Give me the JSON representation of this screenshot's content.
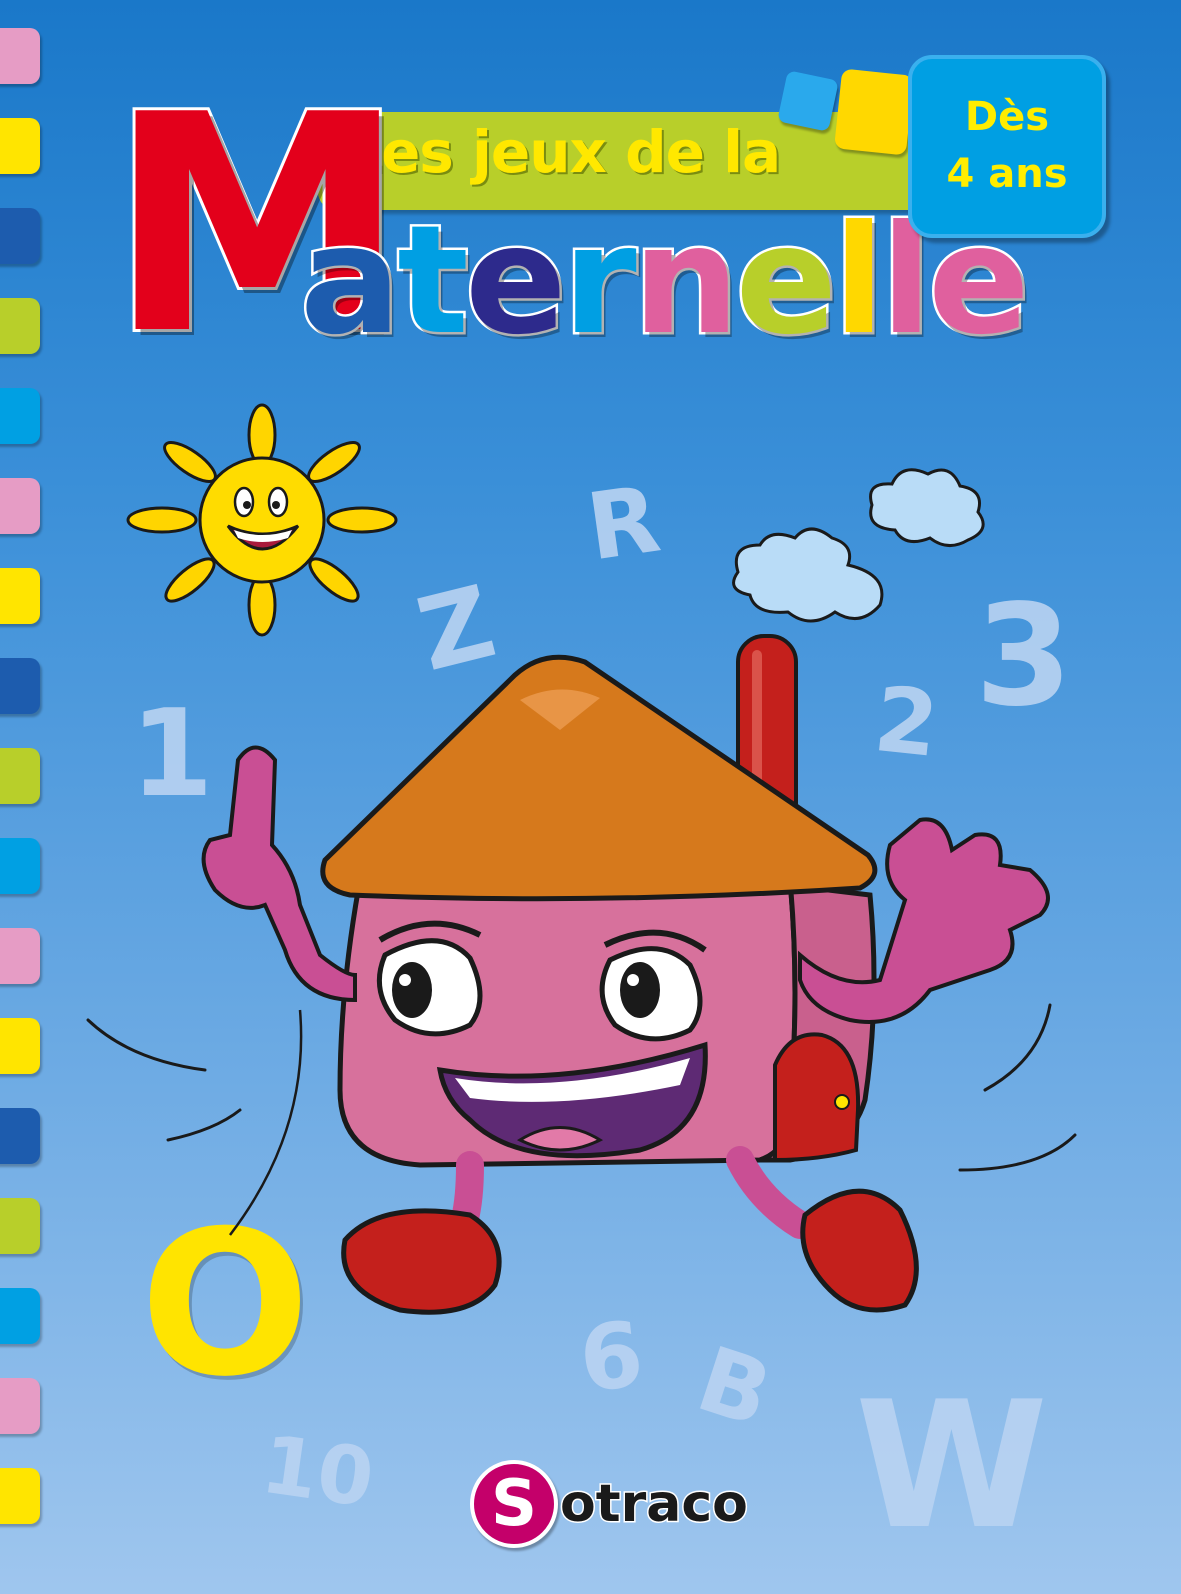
{
  "title": {
    "line1": "Les jeux de la",
    "big_letter": "M",
    "word_rest": [
      {
        "ch": "a",
        "color": "#1d5cae"
      },
      {
        "ch": "t",
        "color": "#009fe3"
      },
      {
        "ch": "e",
        "color": "#2d2a8c"
      },
      {
        "ch": "r",
        "color": "#009fe3"
      },
      {
        "ch": "n",
        "color": "#e0609e"
      },
      {
        "ch": "e",
        "color": "#b8cf2a"
      },
      {
        "ch": "l",
        "color": "#ffd800"
      },
      {
        "ch": "l",
        "color": "#e0609e"
      },
      {
        "ch": "e",
        "color": "#e0609e"
      }
    ]
  },
  "age_badge": {
    "line1": "Dès",
    "line2": "4 ans"
  },
  "floating_glyphs": [
    "R",
    "Z",
    "3",
    "1",
    "2",
    "O",
    "6",
    "B",
    "10",
    "W"
  ],
  "publisher": {
    "logo_letter": "S",
    "name": "otraco"
  },
  "colors": {
    "background_top": "#1a78c9",
    "background_bottom": "#9fc6ee",
    "tab_colors": [
      "#e69cc5",
      "#ffe500",
      "#1d5cae",
      "#b8cf2a",
      "#00a0e3",
      "#e69cc5",
      "#ffe500",
      "#1d5cae",
      "#b8cf2a",
      "#00a0e3",
      "#e69cc5",
      "#ffe500",
      "#1d5cae",
      "#b8cf2a",
      "#00a0e3",
      "#e69cc5",
      "#ffe500"
    ]
  },
  "illustration": [
    "sun-character",
    "house-character",
    "clouds"
  ]
}
